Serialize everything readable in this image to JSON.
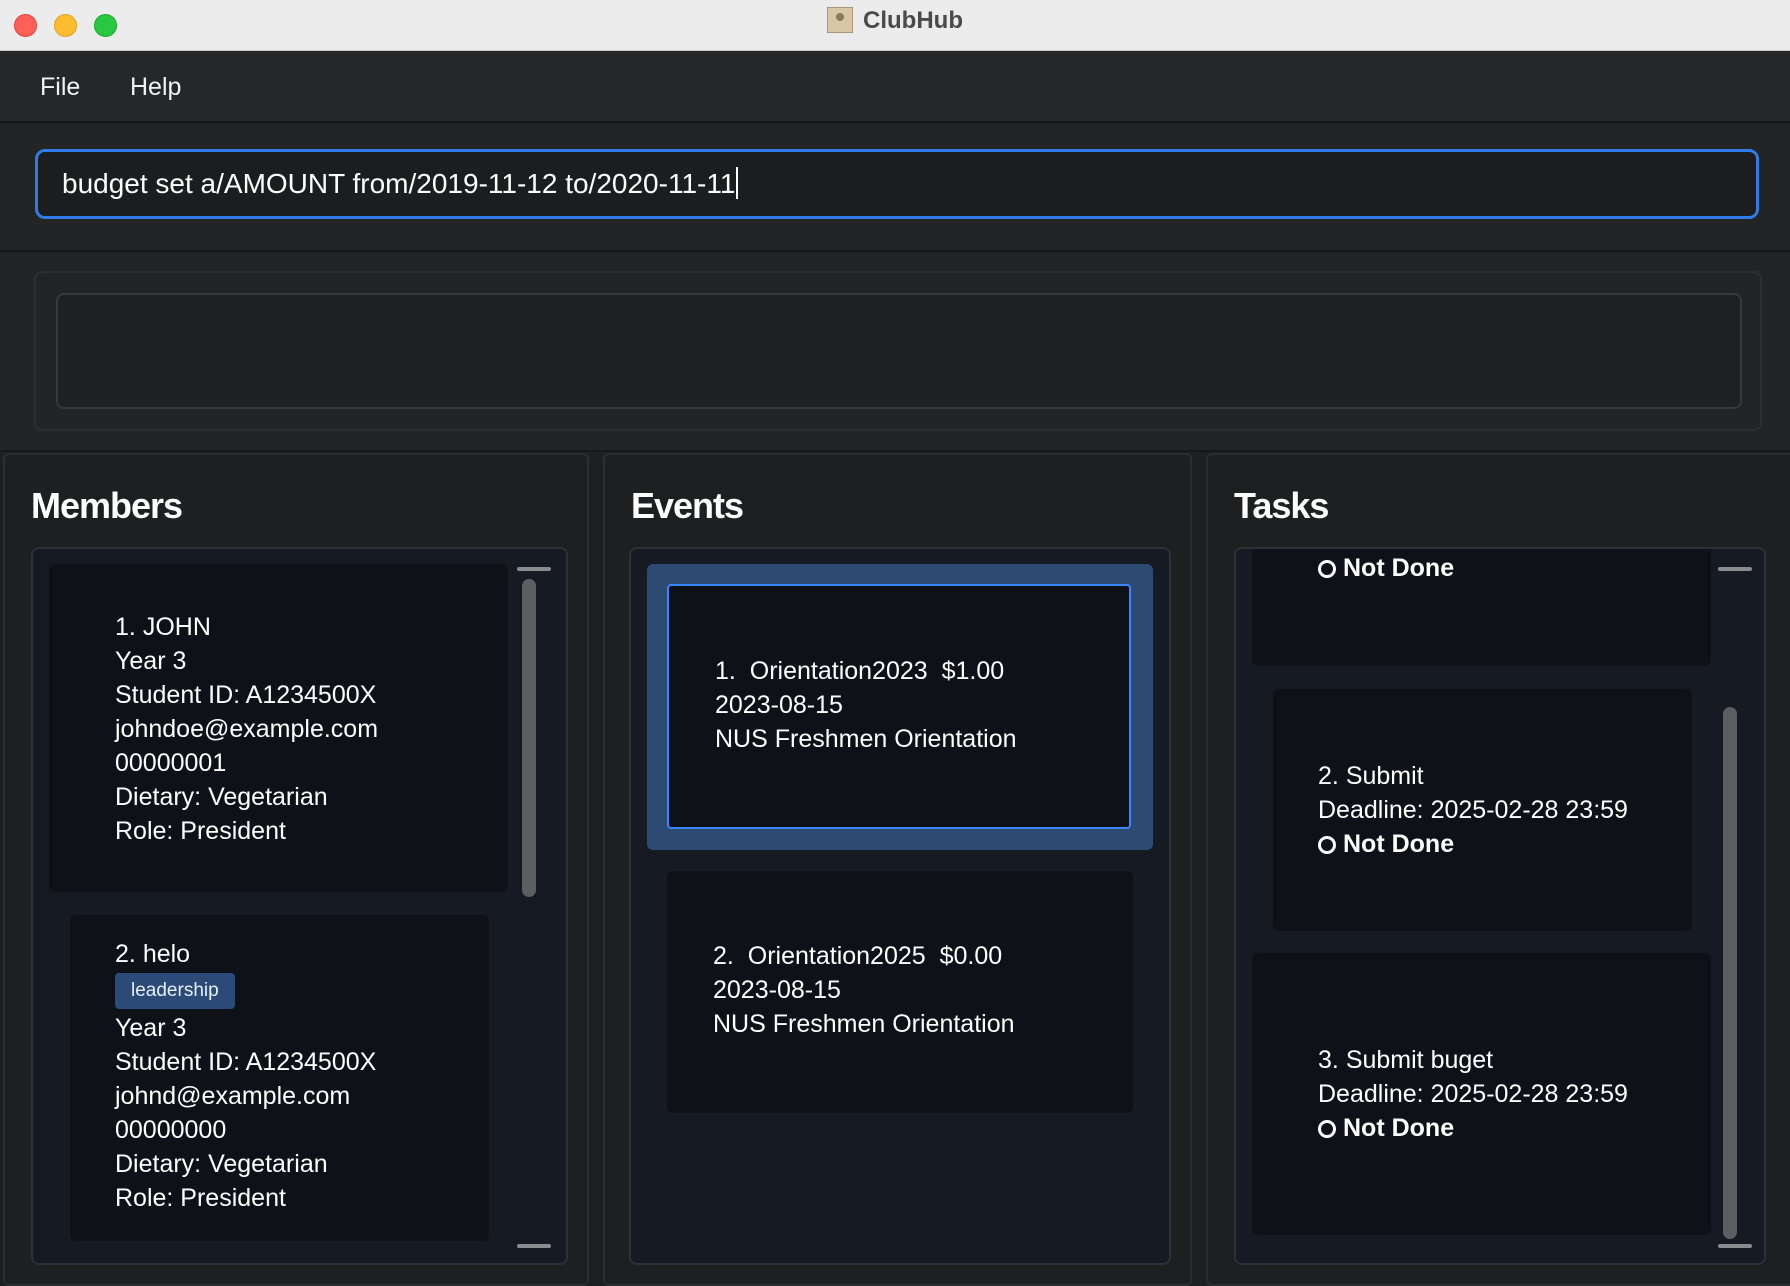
{
  "window": {
    "title": "ClubHub",
    "controls": [
      "close",
      "minimize",
      "maximize"
    ],
    "icon": "address-book-icon"
  },
  "menu": {
    "items": [
      {
        "label": "File"
      },
      {
        "label": "Help"
      }
    ]
  },
  "command": {
    "value": "budget set a/AMOUNT from/2019-11-12 to/2020-11-11"
  },
  "result": {
    "text": ""
  },
  "members": {
    "title": "Members",
    "items": [
      {
        "index": "1.",
        "name": "JOHN",
        "tags": [],
        "year": "Year 3",
        "student_id": "Student ID: A1234500X",
        "email": "johndoe@example.com",
        "phone": "00000001",
        "dietary": "Dietary: Vegetarian",
        "role": "Role: President"
      },
      {
        "index": "2.",
        "name": "helo",
        "tags": [
          "leadership"
        ],
        "year": "Year 3",
        "student_id": "Student ID: A1234500X",
        "email": "johnd@example.com",
        "phone": "00000000",
        "dietary": "Dietary: Vegetarian",
        "role": "Role: President"
      }
    ]
  },
  "events": {
    "title": "Events",
    "selected_index": 0,
    "items": [
      {
        "index": "1.",
        "name": "Orientation2023",
        "amount": "$1.00",
        "date": "2023-08-15",
        "description": "NUS Freshmen Orientation"
      },
      {
        "index": "2.",
        "name": "Orientation2025",
        "amount": "$0.00",
        "date": "2023-08-15",
        "description": "NUS Freshmen Orientation"
      }
    ]
  },
  "tasks": {
    "title": "Tasks",
    "items": [
      {
        "status": "Not Done"
      },
      {
        "index": "2.",
        "name": "Submit",
        "deadline": "Deadline: 2025-02-28 23:59",
        "status": "Not Done"
      },
      {
        "index": "3.",
        "name": "Submit buget",
        "deadline": "Deadline: 2025-02-28 23:59",
        "status": "Not Done"
      }
    ]
  },
  "colors": {
    "accent": "#3a86ff",
    "background": "#1e1f21",
    "card": "#0e1118",
    "tag": "#2b4a78",
    "selection": "#2d4a73"
  }
}
